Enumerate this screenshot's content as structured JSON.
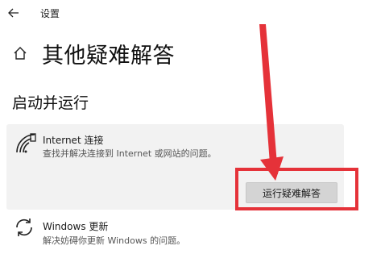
{
  "titlebar": {
    "app_title": "设置",
    "back_icon": "back-arrow-icon"
  },
  "header": {
    "home_icon": "home-icon",
    "page_title": "其他疑难解答"
  },
  "section": {
    "title": "启动并运行"
  },
  "items": [
    {
      "icon": "wifi-icon",
      "title": "Internet 连接",
      "description": "查找并解决连接到 Internet 或网站的问题。",
      "button_label": "运行疑难解答",
      "expanded": true
    },
    {
      "icon": "refresh-icon",
      "title": "Windows 更新",
      "description": "解决妨碍你更新 Windows 的问题。"
    }
  ],
  "annotation": {
    "color": "#e53239"
  }
}
